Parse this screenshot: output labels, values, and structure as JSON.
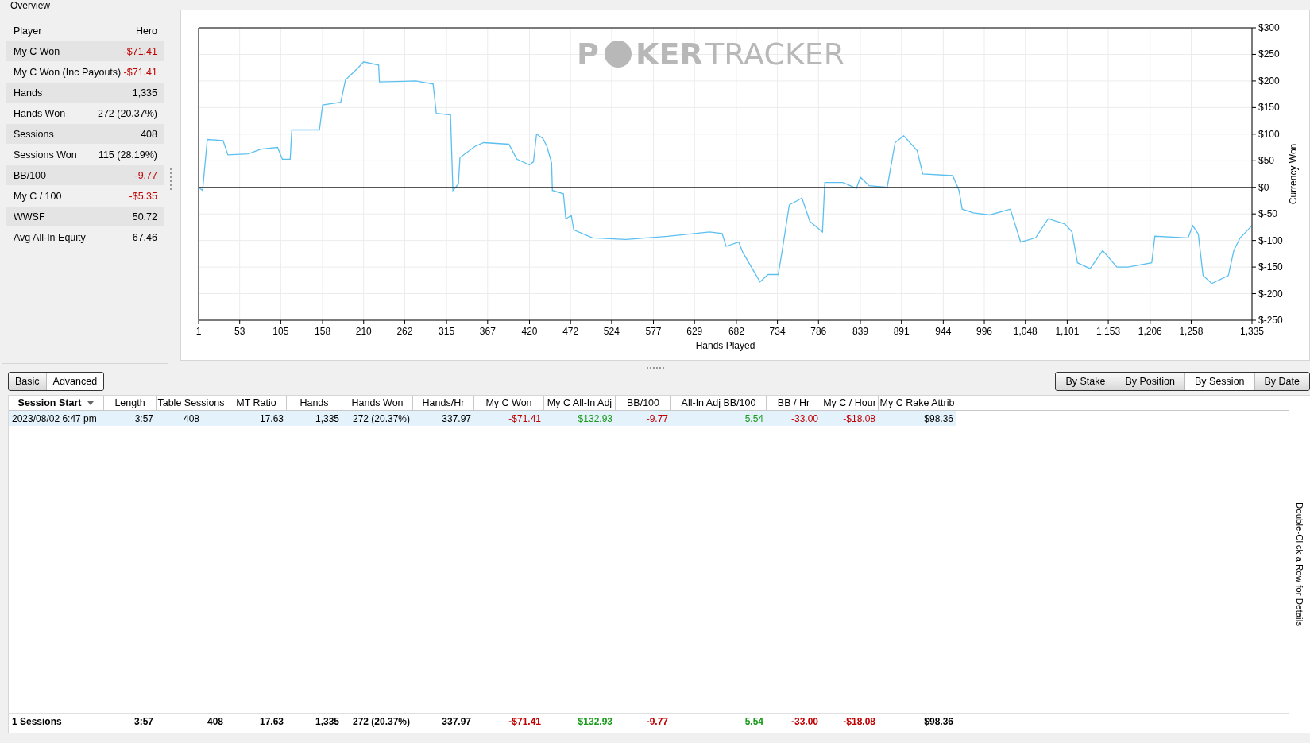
{
  "overview": {
    "title": "Overview",
    "header": {
      "label": "Player",
      "value": "Hero"
    },
    "rows": [
      {
        "label": "My C Won",
        "value": "-$71.41",
        "color": "#c00000"
      },
      {
        "label": "My C Won (Inc Payouts)",
        "value": "-$71.41",
        "color": "#c00000"
      },
      {
        "label": "Hands",
        "value": "1,335",
        "color": "#000000"
      },
      {
        "label": "Hands Won",
        "value": "272 (20.37%)",
        "color": "#000000"
      },
      {
        "label": "Sessions",
        "value": "408",
        "color": "#000000"
      },
      {
        "label": "Sessions Won",
        "value": "115 (28.19%)",
        "color": "#000000"
      },
      {
        "label": "BB/100",
        "value": "-9.77",
        "color": "#c00000"
      },
      {
        "label": "My C / 100",
        "value": "-$5.35",
        "color": "#c00000"
      },
      {
        "label": "WWSF",
        "value": "50.72",
        "color": "#000000"
      },
      {
        "label": "Avg All-In Equity",
        "value": "67.46",
        "color": "#000000"
      }
    ]
  },
  "chart": {
    "logo": {
      "left": "P",
      "middle": "KER",
      "right": "TRACKER"
    },
    "chart_data": {
      "type": "line",
      "grid": true,
      "xlabel": "Hands Played",
      "ylabel": "Currency Won",
      "x": [
        1,
        6,
        12,
        32,
        38,
        64,
        80,
        101,
        107,
        117,
        119,
        154,
        158,
        181,
        187,
        203,
        210,
        229,
        230,
        276,
        298,
        302,
        320,
        323,
        330,
        332,
        351,
        362,
        394,
        404,
        420,
        425,
        429,
        437,
        442,
        448,
        449,
        463,
        466,
        473,
        476,
        500,
        542,
        595,
        648,
        664,
        669,
        685,
        690,
        701,
        712,
        722,
        735,
        740,
        749,
        759,
        765,
        775,
        791,
        794,
        817,
        834,
        839,
        850,
        873,
        883,
        894,
        911,
        918,
        956,
        964,
        968,
        982,
        1003,
        1029,
        1042,
        1061,
        1077,
        1098,
        1107,
        1114,
        1130,
        1146,
        1164,
        1178,
        1208,
        1212,
        1254,
        1260,
        1267,
        1273,
        1284,
        1305,
        1312,
        1320,
        1335
      ],
      "series": [
        {
          "color": "#5bc0f0",
          "values": [
            0,
            -6,
            90,
            88,
            61,
            63,
            72,
            75,
            53,
            53,
            108,
            108,
            155,
            160,
            202,
            225,
            236,
            230,
            198,
            200,
            194,
            139,
            136,
            -6,
            6,
            56,
            77,
            84,
            81,
            53,
            42,
            48,
            100,
            92,
            77,
            46,
            -6,
            -12,
            -59,
            -53,
            -80,
            -95,
            -98,
            -92,
            -84,
            -87,
            -111,
            -103,
            -122,
            -150,
            -178,
            -164,
            -164,
            -119,
            -33,
            -25,
            -20,
            -64,
            -84,
            9,
            9,
            -2,
            19,
            3,
            0,
            84,
            97,
            69,
            25,
            22,
            -6,
            -41,
            -48,
            -52,
            -41,
            -103,
            -95,
            -59,
            -69,
            -84,
            -142,
            -153,
            -119,
            -150,
            -150,
            -142,
            -92,
            -95,
            -72,
            -88,
            -166,
            -181,
            -166,
            -119,
            -95,
            -72
          ]
        }
      ],
      "xlim": [
        1,
        1335
      ],
      "ylim": [
        -250,
        300
      ],
      "xticks": [
        1,
        53,
        105,
        158,
        210,
        262,
        315,
        367,
        420,
        472,
        524,
        577,
        629,
        682,
        734,
        786,
        839,
        891,
        944,
        996,
        {
          "value": 1048,
          "label": "1,048"
        },
        {
          "value": 1101,
          "label": "1,101"
        },
        {
          "value": 1153,
          "label": "1,153"
        },
        {
          "value": 1206,
          "label": "1,206"
        },
        {
          "value": 1258,
          "label": "1,258"
        },
        {
          "value": 1335,
          "label": "1,335"
        }
      ],
      "yticks": [
        {
          "value": 300,
          "label": "$300"
        },
        {
          "value": 250,
          "label": "$250"
        },
        {
          "value": 200,
          "label": "$200"
        },
        {
          "value": 150,
          "label": "$150"
        },
        {
          "value": 100,
          "label": "$100"
        },
        {
          "value": 50,
          "label": "$50"
        },
        {
          "value": 0,
          "label": "$0"
        },
        {
          "value": -50,
          "label": "$-50"
        },
        {
          "value": -100,
          "label": "$-100"
        },
        {
          "value": -150,
          "label": "$-150"
        },
        {
          "value": -200,
          "label": "$-200"
        },
        {
          "value": -250,
          "label": "$-250"
        }
      ]
    }
  },
  "view_tabs": [
    {
      "label": "Basic",
      "selected": false
    },
    {
      "label": "Advanced",
      "selected": true
    }
  ],
  "group_tabs": [
    {
      "label": "By Stake",
      "selected": false
    },
    {
      "label": "By Position",
      "selected": false
    },
    {
      "label": "By Session",
      "selected": true
    },
    {
      "label": "By Date",
      "selected": false
    }
  ],
  "table": {
    "columns": [
      {
        "label": "Session Start",
        "sorted": true
      },
      {
        "label": "Length",
        "sorted": false
      },
      {
        "label": "Table Sessions",
        "sorted": false
      },
      {
        "label": "MT Ratio",
        "sorted": false
      },
      {
        "label": "Hands",
        "sorted": false
      },
      {
        "label": "Hands Won",
        "sorted": false
      },
      {
        "label": "Hands/Hr",
        "sorted": false
      },
      {
        "label": "My C Won",
        "sorted": false
      },
      {
        "label": "My C All-In Adj",
        "sorted": false
      },
      {
        "label": "BB/100",
        "sorted": false
      },
      {
        "label": "All-In Adj BB/100",
        "sorted": false
      },
      {
        "label": "BB / Hr",
        "sorted": false
      },
      {
        "label": "My C / Hour",
        "sorted": false
      },
      {
        "label": "My C Rake Attrib",
        "sorted": false
      }
    ],
    "rows": [
      {
        "selected": true,
        "cells": [
          {
            "text": "2023/08/02  6:47 pm",
            "color": "#000000"
          },
          {
            "text": "3:57",
            "color": "#000000"
          },
          {
            "text": "408",
            "color": "#000000"
          },
          {
            "text": "17.63",
            "color": "#000000"
          },
          {
            "text": "1,335",
            "color": "#000000"
          },
          {
            "text": "272 (20.37%)",
            "color": "#000000"
          },
          {
            "text": "337.97",
            "color": "#000000"
          },
          {
            "text": "-$71.41",
            "color": "#c00000"
          },
          {
            "text": "$132.93",
            "color": "#1a9a1a"
          },
          {
            "text": "-9.77",
            "color": "#c00000"
          },
          {
            "text": "5.54",
            "color": "#1a9a1a"
          },
          {
            "text": "-33.00",
            "color": "#c00000"
          },
          {
            "text": "-$18.08",
            "color": "#c00000"
          },
          {
            "text": "$98.36",
            "color": "#000000"
          }
        ]
      }
    ],
    "totals": [
      {
        "text": "1 Sessions",
        "color": "#000000"
      },
      {
        "text": "3:57",
        "color": "#000000"
      },
      {
        "text": "408",
        "color": "#000000"
      },
      {
        "text": "17.63",
        "color": "#000000"
      },
      {
        "text": "1,335",
        "color": "#000000"
      },
      {
        "text": "272 (20.37%)",
        "color": "#000000"
      },
      {
        "text": "337.97",
        "color": "#000000"
      },
      {
        "text": "-$71.41",
        "color": "#c00000"
      },
      {
        "text": "$132.93",
        "color": "#1a9a1a"
      },
      {
        "text": "-9.77",
        "color": "#c00000"
      },
      {
        "text": "5.54",
        "color": "#1a9a1a"
      },
      {
        "text": "-33.00",
        "color": "#c00000"
      },
      {
        "text": "-$18.08",
        "color": "#c00000"
      },
      {
        "text": "$98.36",
        "color": "#000000"
      }
    ]
  },
  "side_hint": "Double-Click a Row for Details"
}
